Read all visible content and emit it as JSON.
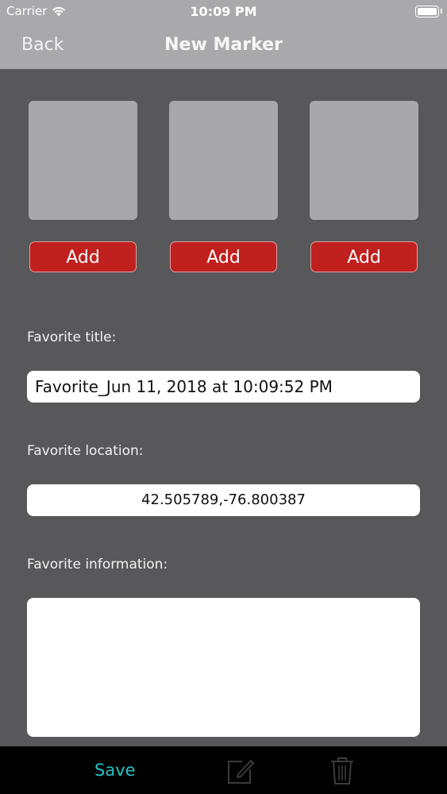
{
  "status": {
    "carrier": "Carrier",
    "time": "10:09 PM"
  },
  "nav": {
    "back_label": "Back",
    "title": "New Marker"
  },
  "photos": [
    {
      "add_label": "Add"
    },
    {
      "add_label": "Add"
    },
    {
      "add_label": "Add"
    }
  ],
  "form": {
    "title_label": "Favorite title:",
    "title_value": "Favorite_Jun 11, 2018 at 10:09:52 PM",
    "location_label": "Favorite location:",
    "location_value": "42.505789,-76.800387",
    "info_label": "Favorite information:",
    "info_value": ""
  },
  "toolbar": {
    "save_label": "Save",
    "edit_icon": "compose-icon",
    "delete_icon": "trash-icon"
  },
  "colors": {
    "header": "#a9a9ab",
    "background": "#58585a",
    "add_button": "#c0201e",
    "save_text": "#27c3c6"
  }
}
